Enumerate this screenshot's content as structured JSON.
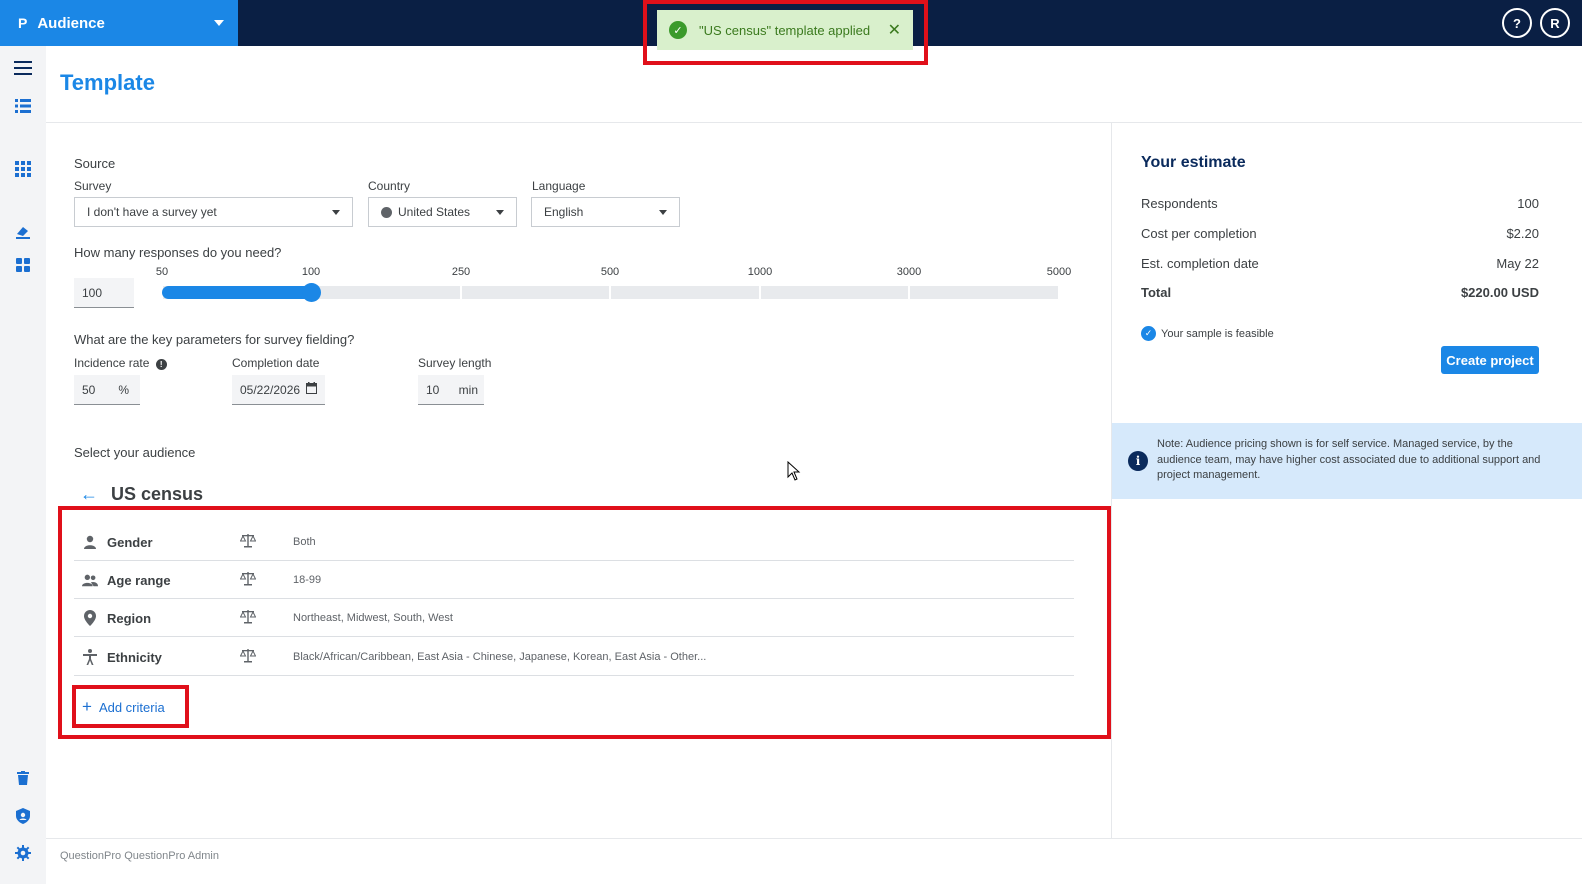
{
  "app": {
    "logo": "P",
    "name": "Audience"
  },
  "topbar": {
    "help_label": "?",
    "avatar_initial": "R"
  },
  "toast": {
    "message": "\"US census\" template applied",
    "close_symbol": "✕"
  },
  "page": {
    "title": "Template"
  },
  "source": {
    "heading": "Source",
    "survey": {
      "label": "Survey",
      "value": "I don't have a survey yet"
    },
    "country": {
      "label": "Country",
      "value": "United States"
    },
    "language": {
      "label": "Language",
      "value": "English"
    }
  },
  "responses": {
    "question": "How many responses do you need?",
    "value": "100",
    "ticks": [
      "50",
      "100",
      "250",
      "500",
      "1000",
      "3000",
      "5000"
    ],
    "selected_value": 100
  },
  "fielding": {
    "question": "What are the key parameters for survey fielding?",
    "incidence": {
      "label": "Incidence rate",
      "value": "50",
      "suffix": "%"
    },
    "completion": {
      "label": "Completion date",
      "value": "05/22/2026"
    },
    "length": {
      "label": "Survey length",
      "value": "10",
      "suffix": "min"
    }
  },
  "audience": {
    "heading": "Select your audience",
    "template_name": "US census",
    "criteria": [
      {
        "icon": "person-icon",
        "name": "Gender",
        "value": "Both"
      },
      {
        "icon": "people-icon",
        "name": "Age range",
        "value": "18-99"
      },
      {
        "icon": "location-pin-icon",
        "name": "Region",
        "value": "Northeast, Midwest, South, West"
      },
      {
        "icon": "accessibility-icon",
        "name": "Ethnicity",
        "value": "Black/African/Caribbean, East Asia - Chinese, Japanese, Korean, East Asia - Other..."
      }
    ],
    "add_label": "Add criteria"
  },
  "estimate": {
    "title": "Your estimate",
    "rows": [
      {
        "label": "Respondents",
        "value": "100"
      },
      {
        "label": "Cost per completion",
        "value": "$2.20"
      },
      {
        "label": "Est. completion date",
        "value": "May 22"
      },
      {
        "label": "Total",
        "value": "$220.00 USD"
      }
    ],
    "feasible": "Your sample is feasible",
    "create_label": "Create project",
    "note": "Note: Audience pricing shown is for self service. Managed service, by the audience team, may have higher cost associated due to additional support and project management."
  },
  "footer": {
    "text": "QuestionPro QuestionPro Admin"
  },
  "colors": {
    "accent": "#1b87e6",
    "topbar": "#0a1f44",
    "highlight": "#e0101a",
    "toast_bg": "#d9f0cc"
  }
}
